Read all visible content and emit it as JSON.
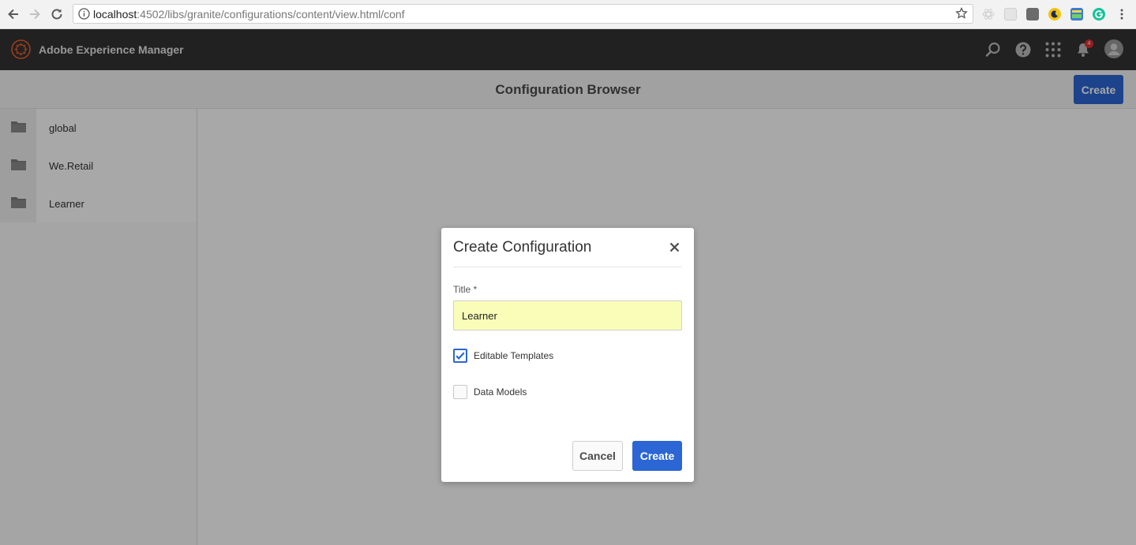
{
  "browser": {
    "url_host": "localhost",
    "url_path": ":4502/libs/granite/configurations/content/view.html/conf"
  },
  "app": {
    "title": "Adobe Experience Manager",
    "notification_count": "4",
    "header_icons": [
      "search-icon",
      "help-icon",
      "apps-grid-icon",
      "bell-icon",
      "avatar"
    ]
  },
  "page": {
    "title": "Configuration Browser",
    "create_label": "Create"
  },
  "rail": {
    "items": [
      {
        "label": "global",
        "icon": "folder-icon"
      },
      {
        "label": "We.Retail",
        "icon": "folder-icon"
      },
      {
        "label": "Learner",
        "icon": "folder-icon"
      }
    ]
  },
  "dialog": {
    "title": "Create Configuration",
    "field_label": "Title *",
    "title_value": "Learner",
    "checkboxes": [
      {
        "label": "Editable Templates",
        "checked": true
      },
      {
        "label": "Data Models",
        "checked": false
      }
    ],
    "cancel_label": "Cancel",
    "create_label": "Create"
  },
  "colors": {
    "accent": "#2b66d4",
    "header_bg": "#323232",
    "input_autofill": "#fafdb8"
  }
}
